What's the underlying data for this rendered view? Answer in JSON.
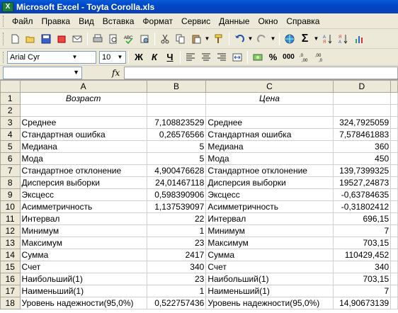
{
  "window": {
    "title": "Microsoft Excel - Toyta Corolla.xls",
    "icon": "excel-icon"
  },
  "menu": [
    "Файл",
    "Правка",
    "Вид",
    "Вставка",
    "Формат",
    "Сервис",
    "Данные",
    "Окно",
    "Справка"
  ],
  "formatting": {
    "font": "Arial Cyr",
    "size": "10",
    "bold": "Ж",
    "italic": "К",
    "underline": "Ч",
    "percent": "%",
    "thousands": "000"
  },
  "formula_bar": {
    "name_box": "",
    "fx": "fx",
    "content": ""
  },
  "columns": [
    "A",
    "B",
    "C",
    "D"
  ],
  "rows": [
    {
      "n": "1",
      "a": "Возраст",
      "b": "",
      "c": "Цена",
      "d": ""
    },
    {
      "n": "2",
      "a": "",
      "b": "",
      "c": "",
      "d": ""
    },
    {
      "n": "3",
      "a": "Среднее",
      "b": "7,108823529",
      "c": "Среднее",
      "d": "324,7925059"
    },
    {
      "n": "4",
      "a": "Стандартная ошибка",
      "b": "0,26576566",
      "c": "Стандартная ошибка",
      "d": "7,578461883"
    },
    {
      "n": "5",
      "a": "Медиана",
      "b": "5",
      "c": "Медиана",
      "d": "360"
    },
    {
      "n": "6",
      "a": "Мода",
      "b": "5",
      "c": "Мода",
      "d": "450"
    },
    {
      "n": "7",
      "a": "Стандартное отклонение",
      "b": "4,900476628",
      "c": "Стандартное отклонение",
      "d": "139,7399325"
    },
    {
      "n": "8",
      "a": "Дисперсия выборки",
      "b": "24,01467118",
      "c": "Дисперсия выборки",
      "d": "19527,24873"
    },
    {
      "n": "9",
      "a": "Эксцесс",
      "b": "0,598390906",
      "c": "Эксцесс",
      "d": "-0,63784635"
    },
    {
      "n": "10",
      "a": "Асимметричность",
      "b": "1,137539097",
      "c": "Асимметричность",
      "d": "-0,31802412"
    },
    {
      "n": "11",
      "a": "Интервал",
      "b": "22",
      "c": "Интервал",
      "d": "696,15"
    },
    {
      "n": "12",
      "a": "Минимум",
      "b": "1",
      "c": "Минимум",
      "d": "7"
    },
    {
      "n": "13",
      "a": "Максимум",
      "b": "23",
      "c": "Максимум",
      "d": "703,15"
    },
    {
      "n": "14",
      "a": "Сумма",
      "b": "2417",
      "c": "Сумма",
      "d": "110429,452"
    },
    {
      "n": "15",
      "a": "Счет",
      "b": "340",
      "c": "Счет",
      "d": "340"
    },
    {
      "n": "16",
      "a": "Наибольший(1)",
      "b": "23",
      "c": "Наибольший(1)",
      "d": "703,15"
    },
    {
      "n": "17",
      "a": "Наименьший(1)",
      "b": "1",
      "c": "Наименьший(1)",
      "d": "7"
    },
    {
      "n": "18",
      "a": "Уровень надежности(95,0%)",
      "b": "0,522757436",
      "c": "Уровень надежности(95,0%)",
      "d": "14,90673139"
    }
  ]
}
